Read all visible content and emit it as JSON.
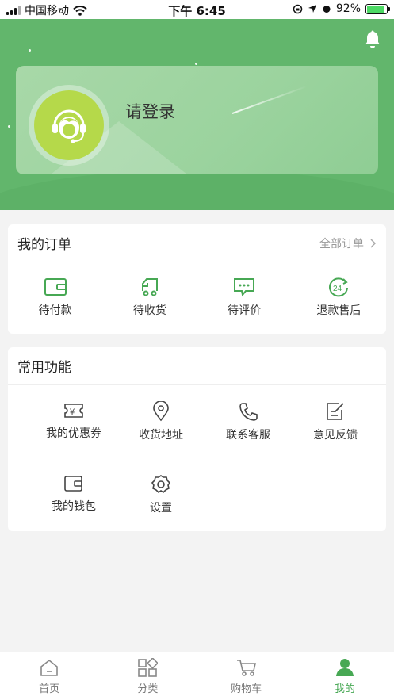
{
  "status_bar": {
    "carrier": "中国移动",
    "time": "下午 6:45",
    "battery": "92%",
    "battery_level": 0.92
  },
  "profile": {
    "login_prompt": "请登录"
  },
  "orders": {
    "title": "我的订单",
    "all_label": "全部订单",
    "items": [
      {
        "label": "待付款",
        "icon": "wallet-icon"
      },
      {
        "label": "待收货",
        "icon": "truck-icon"
      },
      {
        "label": "待评价",
        "icon": "comment-icon"
      },
      {
        "label": "退款售后",
        "icon": "refund-24-icon"
      }
    ]
  },
  "functions": {
    "title": "常用功能",
    "items": [
      {
        "label": "我的优惠券",
        "icon": "coupon-icon"
      },
      {
        "label": "收货地址",
        "icon": "location-pin-icon"
      },
      {
        "label": "联系客服",
        "icon": "phone-icon"
      },
      {
        "label": "意见反馈",
        "icon": "edit-note-icon"
      },
      {
        "label": "我的钱包",
        "icon": "wallet-icon"
      },
      {
        "label": "设置",
        "icon": "gear-icon"
      }
    ]
  },
  "tabbar": {
    "active_index": 3,
    "items": [
      {
        "label": "首页",
        "icon": "home-icon"
      },
      {
        "label": "分类",
        "icon": "category-icon"
      },
      {
        "label": "购物车",
        "icon": "cart-icon"
      },
      {
        "label": "我的",
        "icon": "user-icon"
      }
    ]
  },
  "colors": {
    "header": "#62b66c",
    "accent": "#47a854",
    "avatar": "#b5d94a"
  }
}
